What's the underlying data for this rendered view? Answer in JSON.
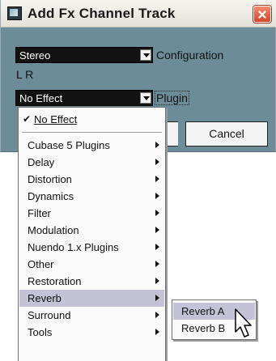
{
  "dialog": {
    "title": "Add Fx Channel Track",
    "configuration_value": "Stereo",
    "configuration_label": "Configuration",
    "channels_label": "L R",
    "plugin_value": "No Effect",
    "plugin_label": "Plugin",
    "cancel_label": "Cancel"
  },
  "plugin_menu": {
    "items": [
      {
        "label": "No Effect",
        "checked": true
      },
      {
        "label": "Cubase 5 Plugins",
        "submenu": true
      },
      {
        "label": "Delay",
        "submenu": true
      },
      {
        "label": "Distortion",
        "submenu": true
      },
      {
        "label": "Dynamics",
        "submenu": true
      },
      {
        "label": "Filter",
        "submenu": true
      },
      {
        "label": "Modulation",
        "submenu": true
      },
      {
        "label": "Nuendo 1.x Plugins",
        "submenu": true
      },
      {
        "label": "Other",
        "submenu": true
      },
      {
        "label": "Restoration",
        "submenu": true
      },
      {
        "label": "Reverb",
        "submenu": true,
        "highlighted": true
      },
      {
        "label": "Surround",
        "submenu": true
      },
      {
        "label": "Tools",
        "submenu": true
      }
    ]
  },
  "reverb_submenu": {
    "items": [
      {
        "label": "Reverb A",
        "highlighted": true
      },
      {
        "label": "Reverb B"
      }
    ]
  },
  "colors": {
    "dialog_bg": "#6c8c9a",
    "highlight": "#c4c2d6",
    "combo_bg": "#121212"
  }
}
